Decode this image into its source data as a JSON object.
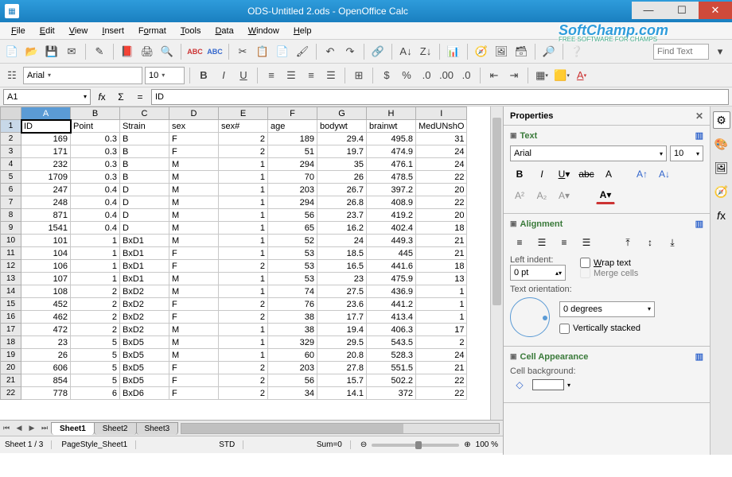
{
  "window": {
    "title": "ODS-Untitled 2.ods - OpenOffice Calc"
  },
  "watermark": {
    "main": "SoftChamp.com",
    "sub": "FREE SOFTWARE FOR CHAMPS"
  },
  "menu": {
    "items": [
      "File",
      "Edit",
      "View",
      "Insert",
      "Format",
      "Tools",
      "Data",
      "Window",
      "Help"
    ]
  },
  "format": {
    "font": "Arial",
    "size": "10"
  },
  "findtext": "Find Text",
  "cell": {
    "ref": "A1",
    "content": "ID"
  },
  "columns": [
    "A",
    "B",
    "C",
    "D",
    "E",
    "F",
    "G",
    "H",
    "I"
  ],
  "headers": [
    "ID",
    "Point",
    "Strain",
    "sex",
    "sex#",
    "age",
    "bodywt",
    "brainwt",
    "MedUNshO"
  ],
  "rows": [
    [
      "169",
      "0.3",
      "B",
      "F",
      "2",
      "189",
      "29.4",
      "495.8",
      "31"
    ],
    [
      "171",
      "0.3",
      "B",
      "F",
      "2",
      "51",
      "19.7",
      "474.9",
      "24"
    ],
    [
      "232",
      "0.3",
      "B",
      "M",
      "1",
      "294",
      "35",
      "476.1",
      "24"
    ],
    [
      "1709",
      "0.3",
      "B",
      "M",
      "1",
      "70",
      "26",
      "478.5",
      "22"
    ],
    [
      "247",
      "0.4",
      "D",
      "M",
      "1",
      "203",
      "26.7",
      "397.2",
      "20"
    ],
    [
      "248",
      "0.4",
      "D",
      "M",
      "1",
      "294",
      "26.8",
      "408.9",
      "22"
    ],
    [
      "871",
      "0.4",
      "D",
      "M",
      "1",
      "56",
      "23.7",
      "419.2",
      "20"
    ],
    [
      "1541",
      "0.4",
      "D",
      "M",
      "1",
      "65",
      "16.2",
      "402.4",
      "18"
    ],
    [
      "101",
      "1",
      "BxD1",
      "M",
      "1",
      "52",
      "24",
      "449.3",
      "21"
    ],
    [
      "104",
      "1",
      "BxD1",
      "F",
      "1",
      "53",
      "18.5",
      "445",
      "21"
    ],
    [
      "106",
      "1",
      "BxD1",
      "F",
      "2",
      "53",
      "16.5",
      "441.6",
      "18"
    ],
    [
      "107",
      "1",
      "BxD1",
      "M",
      "1",
      "53",
      "23",
      "475.9",
      "13"
    ],
    [
      "108",
      "2",
      "BxD2",
      "M",
      "1",
      "74",
      "27.5",
      "436.9",
      "1"
    ],
    [
      "452",
      "2",
      "BxD2",
      "F",
      "2",
      "76",
      "23.6",
      "441.2",
      "1"
    ],
    [
      "462",
      "2",
      "BxD2",
      "F",
      "2",
      "38",
      "17.7",
      "413.4",
      "1"
    ],
    [
      "472",
      "2",
      "BxD2",
      "M",
      "1",
      "38",
      "19.4",
      "406.3",
      "17"
    ],
    [
      "23",
      "5",
      "BxD5",
      "M",
      "1",
      "329",
      "29.5",
      "543.5",
      "2"
    ],
    [
      "26",
      "5",
      "BxD5",
      "M",
      "1",
      "60",
      "20.8",
      "528.3",
      "24"
    ],
    [
      "606",
      "5",
      "BxD5",
      "F",
      "2",
      "203",
      "27.8",
      "551.5",
      "21"
    ],
    [
      "854",
      "5",
      "BxD5",
      "F",
      "2",
      "56",
      "15.7",
      "502.2",
      "22"
    ],
    [
      "778",
      "6",
      "BxD6",
      "F",
      "2",
      "34",
      "14.1",
      "372",
      "22"
    ]
  ],
  "tabs": {
    "items": [
      "Sheet1",
      "Sheet2",
      "Sheet3"
    ],
    "active": 0
  },
  "status": {
    "sheet": "Sheet 1 / 3",
    "pagestyle": "PageStyle_Sheet1",
    "mode": "STD",
    "sum": "Sum=0",
    "zoom": "100 %"
  },
  "panel": {
    "title": "Properties",
    "text": {
      "title": "Text",
      "font": "Arial",
      "size": "10"
    },
    "align": {
      "title": "Alignment",
      "leftindent_label": "Left indent:",
      "leftindent_val": "0 pt",
      "wrap": "Wrap text",
      "merge": "Merge cells",
      "orient_label": "Text orientation:",
      "orient_val": "0 degrees",
      "vstacked": "Vertically stacked"
    },
    "cellapp": {
      "title": "Cell Appearance",
      "bg_label": "Cell background:"
    }
  }
}
